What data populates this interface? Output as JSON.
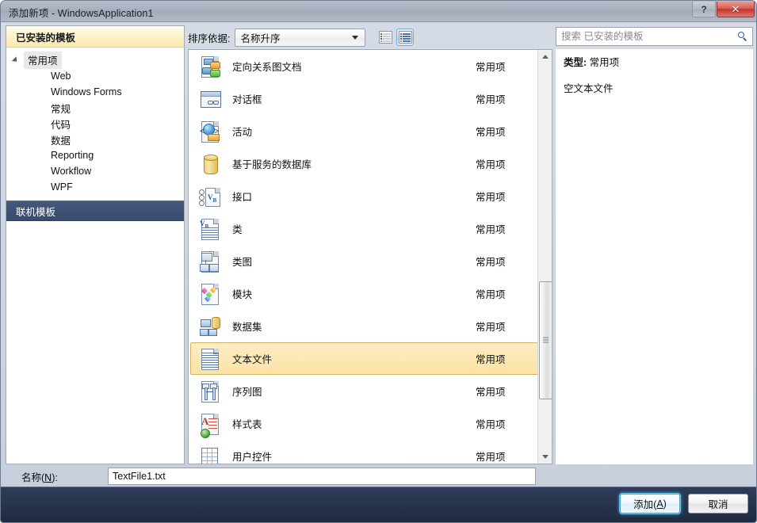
{
  "window": {
    "title": "添加新项 - WindowsApplication1",
    "help_button": "?",
    "close_button": "✕"
  },
  "sidebar": {
    "header": "已安装的模板",
    "tree": [
      {
        "label": "常用项",
        "level": 0,
        "expanded": true,
        "selected": true
      },
      {
        "label": "Web",
        "level": 1
      },
      {
        "label": "Windows Forms",
        "level": 1
      },
      {
        "label": "常规",
        "level": 1
      },
      {
        "label": "代码",
        "level": 1
      },
      {
        "label": "数据",
        "level": 1
      },
      {
        "label": "Reporting",
        "level": 1
      },
      {
        "label": "Workflow",
        "level": 1
      },
      {
        "label": "WPF",
        "level": 1
      }
    ],
    "online_templates": "联机模板"
  },
  "toolbar": {
    "sort_label": "排序依据:",
    "sort_value": "名称升序",
    "view_medium_icons": "medium-icons-view",
    "view_large_icons": "large-icons-view",
    "active_view": "large-icons-view"
  },
  "templates": {
    "items": [
      {
        "name": "定向关系图文档",
        "category": "常用项",
        "icon": "directed-graph-document-icon",
        "selected": false
      },
      {
        "name": "对话框",
        "category": "常用项",
        "icon": "dialog-icon",
        "selected": false
      },
      {
        "name": "活动",
        "category": "常用项",
        "icon": "activity-icon",
        "selected": false
      },
      {
        "name": "基于服务的数据库",
        "category": "常用项",
        "icon": "service-database-icon",
        "selected": false
      },
      {
        "name": "接口",
        "category": "常用项",
        "icon": "interface-icon",
        "selected": false
      },
      {
        "name": "类",
        "category": "常用项",
        "icon": "class-icon",
        "selected": false
      },
      {
        "name": "类图",
        "category": "常用项",
        "icon": "class-diagram-icon",
        "selected": false
      },
      {
        "name": "模块",
        "category": "常用项",
        "icon": "module-icon",
        "selected": false
      },
      {
        "name": "数据集",
        "category": "常用项",
        "icon": "dataset-icon",
        "selected": false
      },
      {
        "name": "文本文件",
        "category": "常用项",
        "icon": "text-file-icon",
        "selected": true
      },
      {
        "name": "序列图",
        "category": "常用项",
        "icon": "sequence-diagram-icon",
        "selected": false
      },
      {
        "name": "样式表",
        "category": "常用项",
        "icon": "style-sheet-icon",
        "selected": false
      },
      {
        "name": "用户控件",
        "category": "常用项",
        "icon": "user-control-icon",
        "selected": false
      }
    ]
  },
  "search": {
    "placeholder": "搜索 已安装的模板",
    "value": "",
    "icon": "search-icon"
  },
  "details": {
    "type_key": "类型:",
    "type_value": "常用项",
    "description": "空文本文件"
  },
  "name_field": {
    "label_prefix": "名称(",
    "label_accel": "N",
    "label_suffix": "):",
    "value": "TextFile1.txt"
  },
  "footer": {
    "add_prefix": "添加(",
    "add_accel": "A",
    "add_suffix": ")",
    "cancel": "取消"
  },
  "colors": {
    "selection_fill": "#fbe3a6",
    "selection_border": "#d5b263",
    "online_bar": "#3e5174",
    "header_gradient_top": "#fdfbe9",
    "footer_bar": "#27344c",
    "default_button_glow": "#66c8ef",
    "close_button": "#c4342a"
  }
}
